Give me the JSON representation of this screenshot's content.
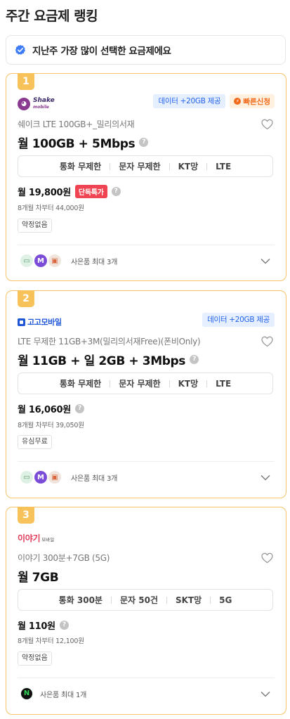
{
  "page": {
    "title": "주간 요금제 랭킹"
  },
  "notice": {
    "text": "지난주 가장 많이 선택한 요금제에요",
    "icon": "check-badge-icon"
  },
  "cards": [
    {
      "rank": "1",
      "logo": {
        "name": "Shake",
        "sub": "mobile"
      },
      "badges": {
        "data": "데이터 +20GB 제공",
        "fast": "빠른신청"
      },
      "plan_name": "쉐이크 LTE 100GB+_밀리의서재",
      "plan_title": "월 100GB + 5Mbps",
      "specs": [
        "통화 무제한",
        "문자 무제한",
        "KT망",
        "LTE"
      ],
      "price": "월 19,800원",
      "exclusive": "단독특가",
      "after_price": "8개월 차부터 44,000원",
      "tag": "약정없음",
      "gifts_label": "사은품 최대 3개"
    },
    {
      "rank": "2",
      "logo": {
        "name": "고고모바일"
      },
      "badges": {
        "data": "데이터 +20GB 제공"
      },
      "plan_name": "LTE 무제한 11GB+3M(밀리의서재Free)(폰비Only)",
      "plan_title": "월 11GB + 일 2GB + 3Mbps",
      "specs": [
        "통화 무제한",
        "문자 무제한",
        "KT망",
        "LTE"
      ],
      "price": "월 16,060원",
      "after_price": "8개월 차부터 39,050원",
      "tag": "유심무료",
      "gifts_label": "사은품 최대 3개"
    },
    {
      "rank": "3",
      "logo": {
        "name": "이야기",
        "sub": "모바일"
      },
      "plan_name": "이야기 300분+7GB (5G)",
      "plan_title": "월 7GB",
      "specs": [
        "통화 300분",
        "문자 50건",
        "SKT망",
        "5G"
      ],
      "price": "월 110원",
      "after_price": "8개월 차부터 12,100원",
      "tag": "약정없음",
      "gifts_label": "사은품 최대 1개"
    }
  ],
  "colors": {
    "accent": "#f5c267",
    "rank_bg": "#f8c25a",
    "exclusive": "#f04452",
    "data_badge": "#2563eb"
  }
}
